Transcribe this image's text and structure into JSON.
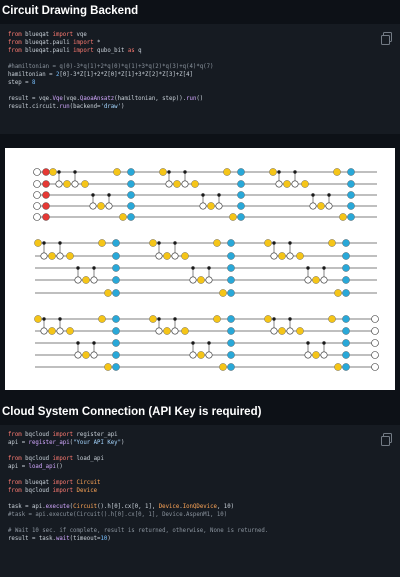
{
  "section1": {
    "title": "Circuit Drawing Backend",
    "lines": [
      [
        [
          "kw",
          "from"
        ],
        [
          "t",
          " blueqat "
        ],
        [
          "kw",
          "import"
        ],
        [
          "t",
          " vqe"
        ]
      ],
      [
        [
          "kw",
          "from"
        ],
        [
          "t",
          " blueqat.pauli "
        ],
        [
          "kw",
          "import"
        ],
        [
          "t",
          " *"
        ]
      ],
      [
        [
          "kw",
          "from"
        ],
        [
          "t",
          " blueqat.pauli "
        ],
        [
          "kw",
          "import"
        ],
        [
          "t",
          " qubo_bit "
        ],
        [
          "kw",
          "as"
        ],
        [
          "t",
          " q"
        ]
      ],
      [
        [
          "t",
          ""
        ]
      ],
      [
        [
          "cm",
          "#hamiltonian = q(0)-3*q(1)+2*q(0)*q(1)+3*q(2)*q(3)+q(4)*q(7)"
        ]
      ],
      [
        [
          "t",
          "hamiltonian = "
        ],
        [
          "num",
          "2"
        ],
        [
          "t",
          "[0]-3*Z[1]+2*Z[0]*Z[1]+3*Z[2]*Z[3]+Z[4]"
        ]
      ],
      [
        [
          "t",
          "step = "
        ],
        [
          "num",
          "8"
        ]
      ],
      [
        [
          "t",
          ""
        ]
      ],
      [
        [
          "t",
          "result = vqe."
        ],
        [
          "fn",
          "Vqe"
        ],
        [
          "t",
          "(vqe."
        ],
        [
          "fn",
          "QaoaAnsatz"
        ],
        [
          "t",
          "(hamiltonian, step))."
        ],
        [
          "fn",
          "run"
        ],
        [
          "t",
          "()"
        ]
      ],
      [
        [
          "t",
          "result.circuit."
        ],
        [
          "fn",
          "run"
        ],
        [
          "t",
          "(backend="
        ],
        [
          "str",
          "'draw'"
        ],
        [
          "t",
          ")"
        ]
      ]
    ]
  },
  "section2": {
    "title": "Cloud System Connection (API Key is required)",
    "lines": [
      [
        [
          "kw",
          "from"
        ],
        [
          "t",
          " bqcloud "
        ],
        [
          "kw",
          "import"
        ],
        [
          "t",
          " register_api"
        ]
      ],
      [
        [
          "t",
          "api = "
        ],
        [
          "fn",
          "register_api"
        ],
        [
          "t",
          "("
        ],
        [
          "str",
          "\"Your API Key\""
        ],
        [
          "t",
          ")"
        ]
      ],
      [
        [
          "t",
          ""
        ]
      ],
      [
        [
          "kw",
          "from"
        ],
        [
          "t",
          " bqcloud "
        ],
        [
          "kw",
          "import"
        ],
        [
          "t",
          " load_api"
        ]
      ],
      [
        [
          "t",
          "api = "
        ],
        [
          "fn",
          "load_api"
        ],
        [
          "t",
          "()"
        ]
      ],
      [
        [
          "t",
          ""
        ]
      ],
      [
        [
          "kw",
          "from"
        ],
        [
          "t",
          " blueqat "
        ],
        [
          "kw",
          "import"
        ],
        [
          "t",
          " "
        ],
        [
          "cls",
          "Circuit"
        ]
      ],
      [
        [
          "kw",
          "from"
        ],
        [
          "t",
          " bqcloud "
        ],
        [
          "kw",
          "import"
        ],
        [
          "t",
          " "
        ],
        [
          "cls",
          "Device"
        ]
      ],
      [
        [
          "t",
          ""
        ]
      ],
      [
        [
          "t",
          "task = api."
        ],
        [
          "fn",
          "execute"
        ],
        [
          "t",
          "("
        ],
        [
          "cls",
          "Circuit"
        ],
        [
          "t",
          "().h[0].cx[0, 1], "
        ],
        [
          "cls",
          "Device"
        ],
        [
          "t",
          "."
        ],
        [
          "cls",
          "IonQDevice"
        ],
        [
          "t",
          ", 10)"
        ]
      ],
      [
        [
          "cm",
          "#task = api.execute(Circuit().h[0].cx[0, 1], Device.AspenM1, 10)"
        ]
      ],
      [
        [
          "t",
          ""
        ]
      ],
      [
        [
          "cm",
          "# Wait 10 sec. if complete, result is returned, otherwise, None is returned."
        ]
      ],
      [
        [
          "t",
          "result = task."
        ],
        [
          "fn",
          "wait"
        ],
        [
          "t",
          "(timeout="
        ],
        [
          "num",
          "10"
        ],
        [
          "t",
          ")"
        ]
      ]
    ]
  },
  "circuit": {
    "qubit_labels": [
      "q0",
      "q1",
      "q2",
      "q3",
      "q4"
    ],
    "gate_colors": {
      "rz": "#f5c518",
      "rx": "#29a8d8",
      "h": "#e53935",
      "control": "#1a1a1a"
    }
  }
}
